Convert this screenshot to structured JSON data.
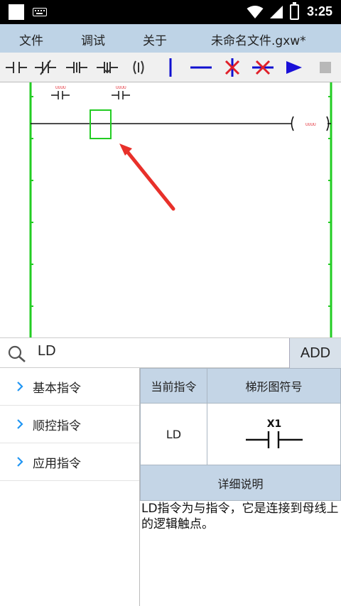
{
  "statusbar": {
    "time": "3:25"
  },
  "menu": {
    "file": "文件",
    "debug": "调试",
    "about": "关于",
    "doc_title": "未命名文件.gxw*"
  },
  "toolbar": {
    "items": [
      "no-contact-icon",
      "nc-contact-icon",
      "rising-contact-icon",
      "falling-contact-icon",
      "coil-icon",
      "vertical-line-icon",
      "horizontal-line-icon",
      "delete-vertical-icon",
      "delete-horizontal-icon",
      "run-icon",
      "stop-icon"
    ],
    "accent": "#1010d0",
    "delete_color": "#e0202a"
  },
  "ladder": {
    "contact1_label": "UUUU",
    "contact2_label": "UUUU",
    "coil_label": "UUUU",
    "rail_color": "#22cc22",
    "cursor_color": "#22cc22",
    "arrow_color": "#e8302a"
  },
  "search": {
    "query": "LD",
    "add_label": "ADD"
  },
  "categories": [
    {
      "label": "基本指令"
    },
    {
      "label": "顺控指令"
    },
    {
      "label": "应用指令"
    }
  ],
  "detail": {
    "col_current": "当前指令",
    "col_symbol": "梯形图符号",
    "current_value": "LD",
    "symbol_label": "X1",
    "desc_header": "详细说明",
    "description": "LD指令为与指令，它是连接到母线上的逻辑触点。"
  }
}
